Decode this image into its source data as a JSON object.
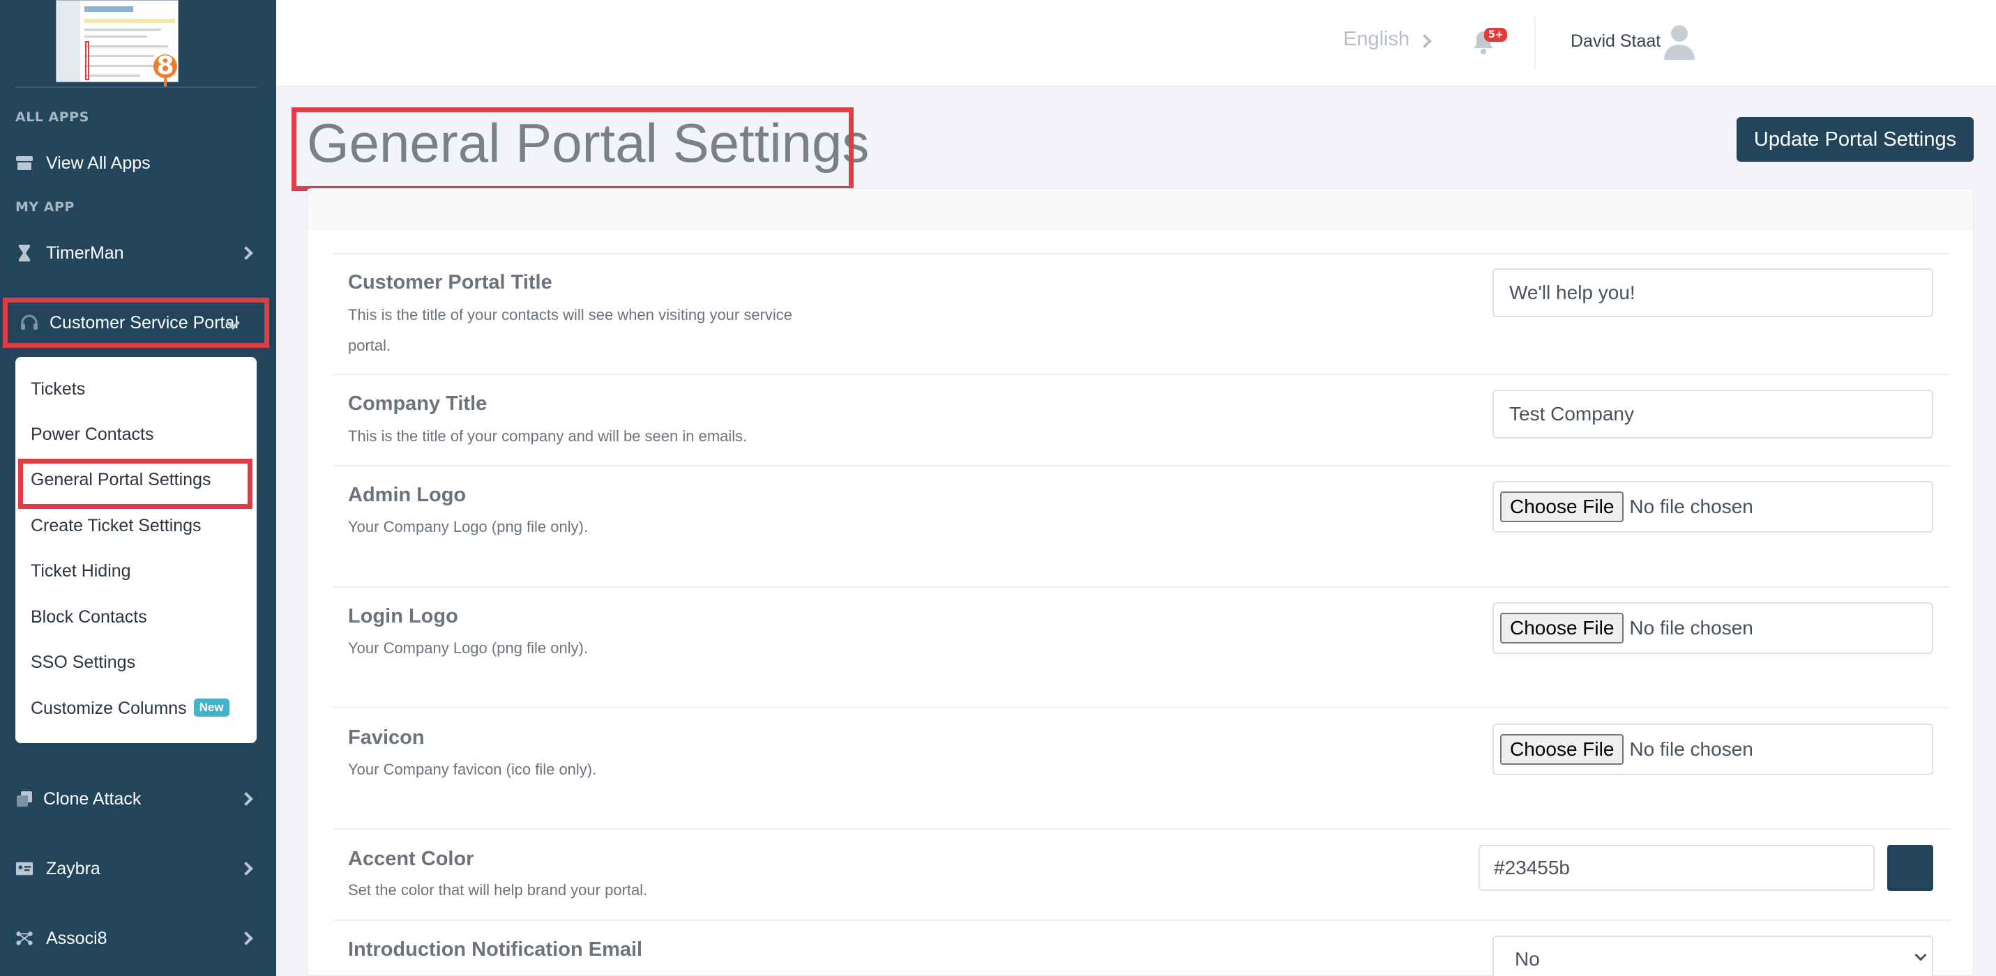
{
  "sidebar": {
    "section_all_apps": "ALL APPS",
    "section_my_app": "MY APP",
    "items": {
      "view_all_apps": "View All Apps",
      "timerman": "TimerMan",
      "customer_service_portal": "Customer Service Portal",
      "clone_attack": "Clone Attack",
      "zaybra": "Zaybra",
      "associ8": "Associ8"
    },
    "submenu": {
      "tickets": "Tickets",
      "power_contacts": "Power Contacts",
      "general_portal_settings": "General Portal Settings",
      "create_ticket_settings": "Create Ticket Settings",
      "ticket_hiding": "Ticket Hiding",
      "block_contacts": "Block Contacts",
      "sso_settings": "SSO Settings",
      "customize_columns": "Customize Columns",
      "new_badge": "New"
    },
    "logo_badge": "8"
  },
  "topbar": {
    "language": "English",
    "notification_count": "5+",
    "user_name": "David Staat"
  },
  "main": {
    "page_title": "General Portal Settings",
    "update_button": "Update Portal Settings",
    "fields": {
      "portal_title": {
        "label": "Customer Portal Title",
        "description": "This is the title of your contacts will see when visiting your service portal.",
        "value": "We'll help you!"
      },
      "company_title": {
        "label": "Company Title",
        "description": "This is the title of your company and will be seen in emails.",
        "value": "Test Company"
      },
      "admin_logo": {
        "label": "Admin Logo",
        "description": "Your Company Logo (png file only).",
        "button": "Choose File",
        "status": "No file chosen"
      },
      "login_logo": {
        "label": "Login Logo",
        "description": "Your Company Logo (png file only).",
        "button": "Choose File",
        "status": "No file chosen"
      },
      "favicon": {
        "label": "Favicon",
        "description": "Your Company favicon (ico file only).",
        "button": "Choose File",
        "status": "No file chosen"
      },
      "accent_color": {
        "label": "Accent Color",
        "description": "Set the color that will help brand your portal.",
        "value": "#23455b"
      },
      "intro_email": {
        "label": "Introduction Notification Email",
        "value": "No"
      }
    }
  },
  "colors": {
    "sidebar": "#23455b",
    "accent": "#23455b",
    "highlight": "#e03c46"
  }
}
